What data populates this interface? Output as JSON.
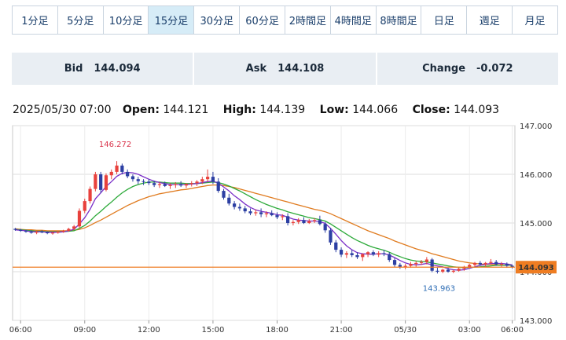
{
  "timeframes": {
    "items": [
      "1分足",
      "5分足",
      "10分足",
      "15分足",
      "30分足",
      "60分足",
      "2時間足",
      "4時間足",
      "8時間足",
      "日足",
      "週足",
      "月足"
    ],
    "active_index": 3
  },
  "quote": {
    "bid_label": "Bid",
    "bid_value": "144.094",
    "ask_label": "Ask",
    "ask_value": "144.108",
    "change_label": "Change",
    "change_value": "-0.072"
  },
  "ohlc": {
    "datetime": "2025/05/30 07:00",
    "open_label": "Open:",
    "open_value": "144.121",
    "high_label": "High:",
    "high_value": "144.139",
    "low_label": "Low:",
    "low_value": "144.066",
    "close_label": "Close:",
    "close_value": "144.093"
  },
  "chart_data": {
    "type": "candlestick",
    "ylim": [
      143.0,
      147.0
    ],
    "y_ticks": [
      "147.000",
      "146.000",
      "145.000",
      "144.000",
      "143.000"
    ],
    "x_labels": [
      "06:00",
      "09:00",
      "12:00",
      "15:00",
      "18:00",
      "21:00",
      "05/30",
      "03:00",
      "06:00"
    ],
    "current_price": "144.093",
    "max_label": "146.272",
    "min_label": "143.963",
    "grid": true,
    "colors": {
      "up": "#e8413c",
      "down": "#2c3fa3",
      "ma_short": "#7a2fc8",
      "ma_mid": "#2daa3a",
      "ma_long": "#e07b1f",
      "price_line": "#ef7d22",
      "max_label": "#d9334a",
      "min_label": "#2f6eb5"
    },
    "candles": [
      [
        144.88,
        144.9,
        144.84,
        144.86
      ],
      [
        144.86,
        144.88,
        144.82,
        144.84
      ],
      [
        144.84,
        144.86,
        144.8,
        144.82
      ],
      [
        144.82,
        144.85,
        144.78,
        144.8
      ],
      [
        144.8,
        144.84,
        144.77,
        144.82
      ],
      [
        144.82,
        144.85,
        144.79,
        144.81
      ],
      [
        144.81,
        144.83,
        144.77,
        144.79
      ],
      [
        144.79,
        144.82,
        144.76,
        144.8
      ],
      [
        144.8,
        144.84,
        144.78,
        144.82
      ],
      [
        144.82,
        144.86,
        144.8,
        144.84
      ],
      [
        144.84,
        144.9,
        144.82,
        144.88
      ],
      [
        144.88,
        144.96,
        144.86,
        144.93
      ],
      [
        144.93,
        145.3,
        144.9,
        145.25
      ],
      [
        145.25,
        145.5,
        145.2,
        145.45
      ],
      [
        145.45,
        145.75,
        145.4,
        145.7
      ],
      [
        145.7,
        146.05,
        145.65,
        146.0
      ],
      [
        146.0,
        146.05,
        145.62,
        145.68
      ],
      [
        145.68,
        146.02,
        145.65,
        145.98
      ],
      [
        145.98,
        146.1,
        145.9,
        146.05
      ],
      [
        146.05,
        146.272,
        146.0,
        146.18
      ],
      [
        146.18,
        146.22,
        146.0,
        146.05
      ],
      [
        146.05,
        146.1,
        145.92,
        145.96
      ],
      [
        145.96,
        146.0,
        145.85,
        145.9
      ],
      [
        145.9,
        145.95,
        145.8,
        145.86
      ],
      [
        145.86,
        145.9,
        145.78,
        145.85
      ],
      [
        145.85,
        145.9,
        145.78,
        145.82
      ],
      [
        145.82,
        145.87,
        145.74,
        145.78
      ],
      [
        145.78,
        145.84,
        145.72,
        145.8
      ],
      [
        145.8,
        145.85,
        145.74,
        145.76
      ],
      [
        145.76,
        145.82,
        145.7,
        145.78
      ],
      [
        145.78,
        145.84,
        145.72,
        145.8
      ],
      [
        145.8,
        145.86,
        145.74,
        145.77
      ],
      [
        145.77,
        145.82,
        145.72,
        145.8
      ],
      [
        145.8,
        145.86,
        145.75,
        145.82
      ],
      [
        145.82,
        145.88,
        145.76,
        145.85
      ],
      [
        145.85,
        145.95,
        145.8,
        145.9
      ],
      [
        145.9,
        146.1,
        145.85,
        145.95
      ],
      [
        145.95,
        146.05,
        145.8,
        145.85
      ],
      [
        145.85,
        145.92,
        145.62,
        145.66
      ],
      [
        145.66,
        145.7,
        145.48,
        145.52
      ],
      [
        145.52,
        145.6,
        145.36,
        145.4
      ],
      [
        145.4,
        145.45,
        145.28,
        145.33
      ],
      [
        145.33,
        145.4,
        145.25,
        145.3
      ],
      [
        145.3,
        145.35,
        145.2,
        145.24
      ],
      [
        145.24,
        145.3,
        145.16,
        145.2
      ],
      [
        145.2,
        145.28,
        145.15,
        145.22
      ],
      [
        145.22,
        145.3,
        145.12,
        145.18
      ],
      [
        145.18,
        145.24,
        145.12,
        145.2
      ],
      [
        145.2,
        145.26,
        145.14,
        145.16
      ],
      [
        145.16,
        145.22,
        145.08,
        145.12
      ],
      [
        145.12,
        145.18,
        145.06,
        145.14
      ],
      [
        145.14,
        145.2,
        144.95,
        145.0
      ],
      [
        145.0,
        145.06,
        144.95,
        145.02
      ],
      [
        145.02,
        145.1,
        144.98,
        145.06
      ],
      [
        145.06,
        145.12,
        144.98,
        145.0
      ],
      [
        145.0,
        145.08,
        144.98,
        145.04
      ],
      [
        145.04,
        145.1,
        145.0,
        145.06
      ],
      [
        145.06,
        145.15,
        144.95,
        144.98
      ],
      [
        144.98,
        145.02,
        144.8,
        144.85
      ],
      [
        144.85,
        144.9,
        144.55,
        144.6
      ],
      [
        144.6,
        144.65,
        144.4,
        144.45
      ],
      [
        144.45,
        144.5,
        144.3,
        144.35
      ],
      [
        144.35,
        144.42,
        144.28,
        144.38
      ],
      [
        144.38,
        144.45,
        144.3,
        144.34
      ],
      [
        144.34,
        144.4,
        144.26,
        144.3
      ],
      [
        144.3,
        144.38,
        144.22,
        144.36
      ],
      [
        144.36,
        144.42,
        144.3,
        144.4
      ],
      [
        144.4,
        144.44,
        144.32,
        144.35
      ],
      [
        144.35,
        144.42,
        144.3,
        144.38
      ],
      [
        144.38,
        144.45,
        144.32,
        144.36
      ],
      [
        144.36,
        144.4,
        144.2,
        144.24
      ],
      [
        144.24,
        144.28,
        144.1,
        144.14
      ],
      [
        144.14,
        144.18,
        144.06,
        144.1
      ],
      [
        144.1,
        144.16,
        144.05,
        144.12
      ],
      [
        144.12,
        144.2,
        144.08,
        144.16
      ],
      [
        144.16,
        144.22,
        144.1,
        144.18
      ],
      [
        144.18,
        144.24,
        144.14,
        144.2
      ],
      [
        144.2,
        144.3,
        144.15,
        144.25
      ],
      [
        144.25,
        144.28,
        143.99,
        144.02
      ],
      [
        144.02,
        144.08,
        143.963,
        144.0
      ],
      [
        144.0,
        144.06,
        143.97,
        144.04
      ],
      [
        144.04,
        144.08,
        143.98,
        144.0
      ],
      [
        144.0,
        144.04,
        143.97,
        144.02
      ],
      [
        144.02,
        144.08,
        144.0,
        144.06
      ],
      [
        144.06,
        144.12,
        144.02,
        144.1
      ],
      [
        144.1,
        144.16,
        144.06,
        144.14
      ],
      [
        144.14,
        144.2,
        144.1,
        144.18
      ],
      [
        144.18,
        144.22,
        144.12,
        144.15
      ],
      [
        144.15,
        144.2,
        144.1,
        144.18
      ],
      [
        144.18,
        144.26,
        144.14,
        144.2
      ],
      [
        144.2,
        144.24,
        144.12,
        144.15
      ],
      [
        144.15,
        144.2,
        144.1,
        144.16
      ],
      [
        144.16,
        144.19,
        144.08,
        144.12
      ],
      [
        144.121,
        144.139,
        144.066,
        144.093
      ]
    ],
    "ma_short": [
      144.86,
      144.85,
      144.84,
      144.82,
      144.82,
      144.82,
      144.81,
      144.81,
      144.81,
      144.82,
      144.84,
      144.87,
      144.98,
      145.11,
      145.28,
      145.5,
      145.62,
      145.75,
      145.85,
      145.96,
      146.02,
      146.04,
      146.03,
      146.0,
      145.95,
      145.9,
      145.86,
      145.83,
      145.81,
      145.79,
      145.79,
      145.79,
      145.79,
      145.8,
      145.81,
      145.83,
      145.85,
      145.86,
      145.82,
      145.74,
      145.66,
      145.56,
      145.48,
      145.39,
      145.32,
      145.27,
      145.24,
      145.22,
      145.2,
      145.17,
      145.16,
      145.12,
      145.08,
      145.06,
      145.05,
      145.04,
      145.04,
      145.03,
      144.99,
      144.89,
      144.77,
      144.64,
      144.53,
      144.45,
      144.39,
      144.37,
      144.36,
      144.36,
      144.37,
      144.37,
      144.34,
      144.29,
      144.23,
      144.18,
      144.15,
      144.14,
      144.15,
      144.17,
      144.14,
      144.12,
      144.1,
      144.06,
      144.04,
      144.03,
      144.04,
      144.07,
      144.1,
      144.13,
      144.15,
      144.17,
      144.17,
      144.17,
      144.16,
      144.14
    ],
    "ma_mid": [
      144.87,
      144.86,
      144.85,
      144.84,
      144.83,
      144.83,
      144.82,
      144.82,
      144.82,
      144.82,
      144.83,
      144.84,
      144.89,
      144.95,
      145.04,
      145.15,
      145.24,
      145.34,
      145.43,
      145.53,
      145.62,
      145.69,
      145.75,
      145.79,
      145.82,
      145.84,
      145.84,
      145.84,
      145.83,
      145.82,
      145.82,
      145.82,
      145.81,
      145.81,
      145.81,
      145.82,
      145.83,
      145.84,
      145.83,
      145.8,
      145.76,
      145.71,
      145.66,
      145.6,
      145.54,
      145.48,
      145.43,
      145.38,
      145.34,
      145.3,
      145.27,
      145.23,
      145.2,
      145.17,
      145.14,
      145.11,
      145.09,
      145.07,
      145.04,
      144.98,
      144.91,
      144.84,
      144.77,
      144.7,
      144.64,
      144.59,
      144.54,
      144.5,
      144.47,
      144.44,
      144.4,
      144.35,
      144.31,
      144.27,
      144.24,
      144.22,
      144.21,
      144.2,
      144.18,
      144.16,
      144.14,
      144.12,
      144.1,
      144.09,
      144.08,
      144.09,
      144.09,
      144.1,
      144.11,
      144.12,
      144.13,
      144.13,
      144.13,
      144.13
    ],
    "ma_long": [
      144.88,
      144.87,
      144.86,
      144.86,
      144.85,
      144.85,
      144.84,
      144.84,
      144.84,
      144.84,
      144.84,
      144.85,
      144.87,
      144.9,
      144.95,
      145.01,
      145.06,
      145.12,
      145.18,
      145.24,
      145.3,
      145.36,
      145.41,
      145.46,
      145.5,
      145.54,
      145.57,
      145.6,
      145.62,
      145.64,
      145.66,
      145.68,
      145.69,
      145.71,
      145.73,
      145.75,
      145.77,
      145.78,
      145.78,
      145.77,
      145.75,
      145.73,
      145.7,
      145.67,
      145.64,
      145.61,
      145.58,
      145.55,
      145.52,
      145.49,
      145.46,
      145.43,
      145.4,
      145.37,
      145.34,
      145.31,
      145.28,
      145.26,
      145.23,
      145.19,
      145.14,
      145.09,
      145.04,
      144.99,
      144.94,
      144.89,
      144.84,
      144.8,
      144.76,
      144.72,
      144.68,
      144.63,
      144.59,
      144.55,
      144.51,
      144.47,
      144.44,
      144.41,
      144.37,
      144.34,
      144.31,
      144.28,
      144.25,
      144.22,
      144.2,
      144.18,
      144.17,
      144.16,
      144.15,
      144.15,
      144.14,
      144.14,
      144.13,
      144.13
    ]
  }
}
